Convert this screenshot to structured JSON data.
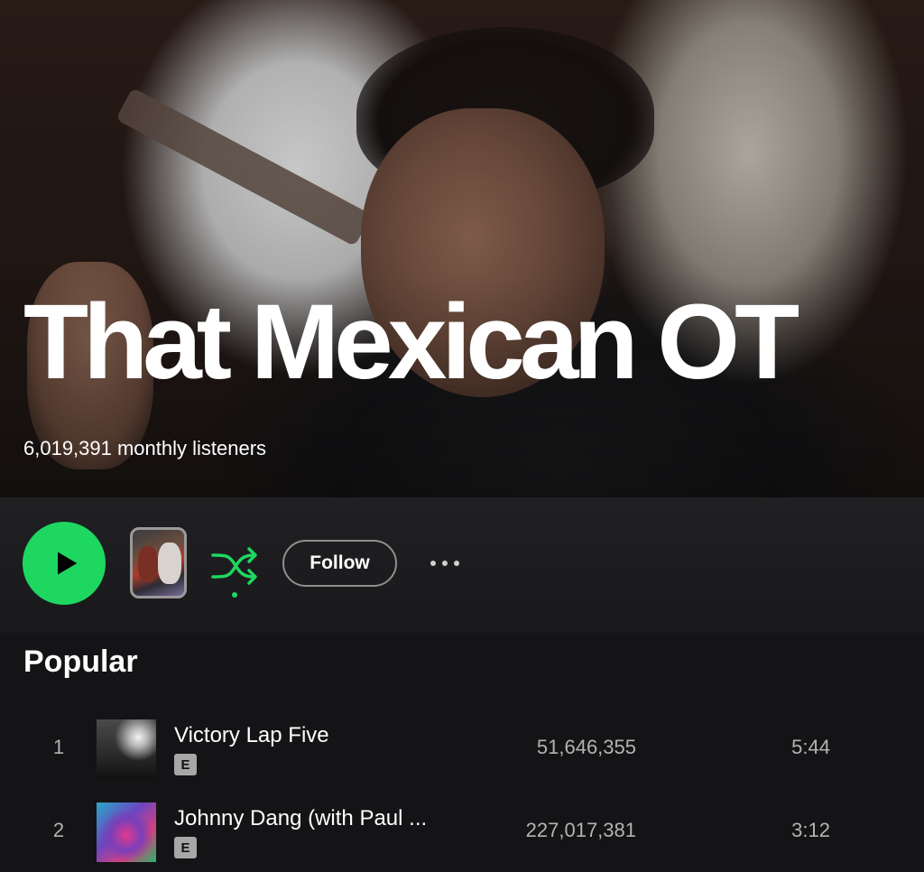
{
  "artist": {
    "name": "That Mexican OT",
    "monthly_listeners": "6,019,391 monthly listeners"
  },
  "controls": {
    "play_icon": "play-icon",
    "shuffle_icon": "shuffle-icon",
    "follow_label": "Follow",
    "more_icon": "more-options-icon",
    "accent_color": "#1ed760"
  },
  "popular": {
    "title": "Popular",
    "tracks": [
      {
        "number": "1",
        "title": "Victory Lap Five",
        "explicit": "E",
        "plays": "51,646,355",
        "duration": "5:44"
      },
      {
        "number": "2",
        "title": "Johnny Dang (with Paul ...",
        "explicit": "E",
        "plays": "227,017,381",
        "duration": "3:12"
      }
    ]
  }
}
